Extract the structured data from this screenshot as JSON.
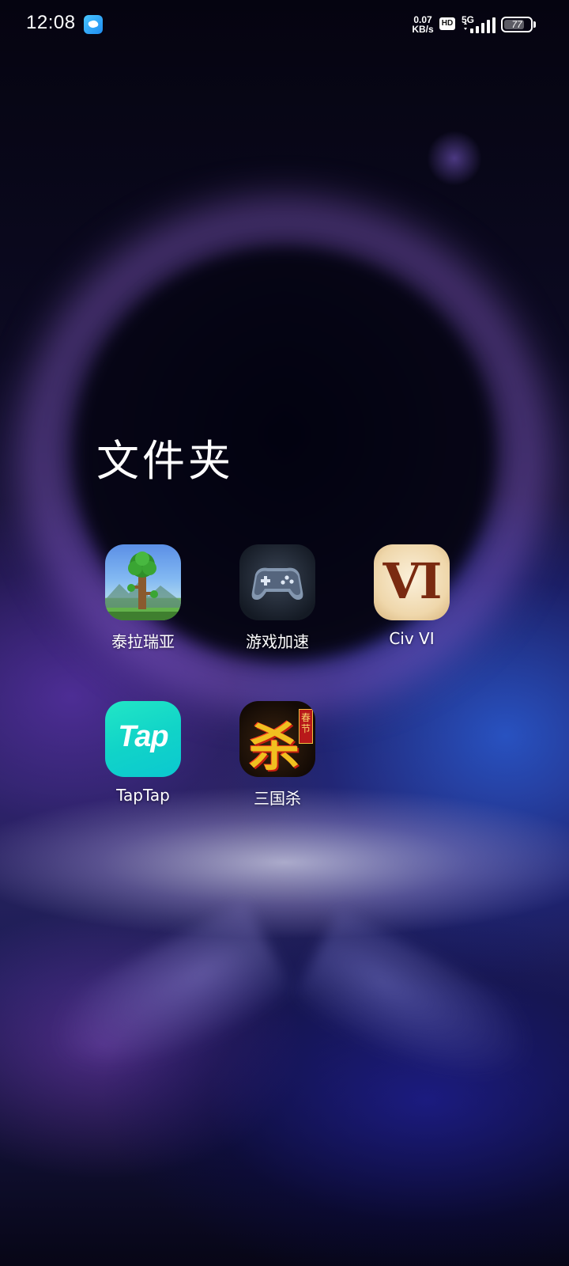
{
  "status_bar": {
    "time": "12:08",
    "net_speed_value": "0.07",
    "net_speed_unit": "KB/s",
    "hd_badge": "HD",
    "network_type": "5G",
    "battery_level": "77",
    "battery_percent": 77
  },
  "folder": {
    "title": "文件夹",
    "apps": [
      {
        "label": "泰拉瑞亚",
        "icon": "terraria-icon"
      },
      {
        "label": "游戏加速",
        "icon": "game-accelerator-icon"
      },
      {
        "label": "Civ VI",
        "icon": "civ-vi-icon",
        "icon_text": "VI"
      },
      {
        "label": "TapTap",
        "icon": "taptap-icon",
        "icon_text": "Tap"
      },
      {
        "label": "三国杀",
        "icon": "sanguosha-icon",
        "icon_text": "杀",
        "icon_tag": "春节"
      }
    ]
  }
}
